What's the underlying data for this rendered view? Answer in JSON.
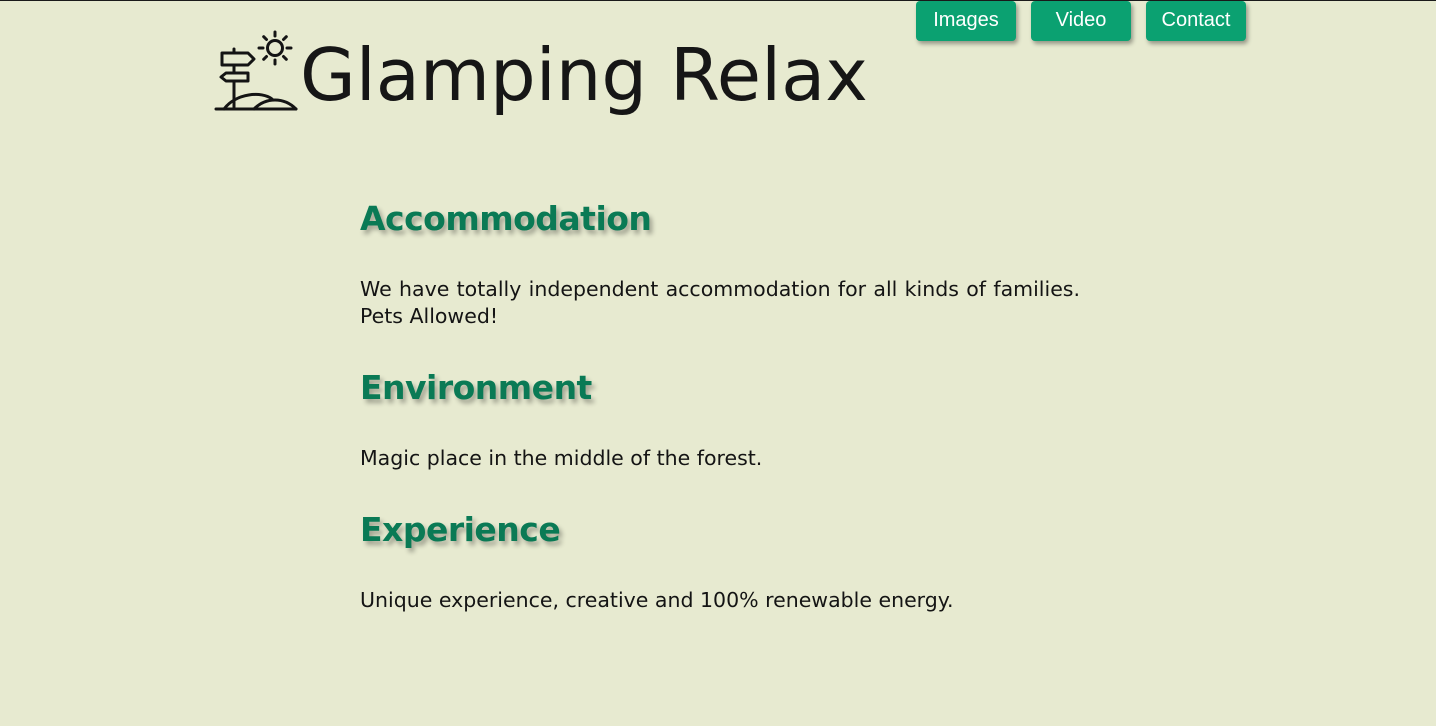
{
  "nav": {
    "items": [
      {
        "label": "Images"
      },
      {
        "label": "Video"
      },
      {
        "label": "Contact"
      }
    ]
  },
  "header": {
    "title": "Glamping Relax",
    "logo_icon": "signpost-sun-icon"
  },
  "sections": [
    {
      "title": "Accommodation",
      "text": "We have totally independent accommodation for all kinds of families. Pets Allowed!"
    },
    {
      "title": "Environment",
      "text": "Magic place in the middle of the forest."
    },
    {
      "title": "Experience",
      "text": "Unique experience, creative and 100% renewable energy."
    }
  ],
  "colors": {
    "background": "#e7ead0",
    "accent": "#0ba171",
    "heading": "#0a7a55",
    "text": "#141414"
  }
}
